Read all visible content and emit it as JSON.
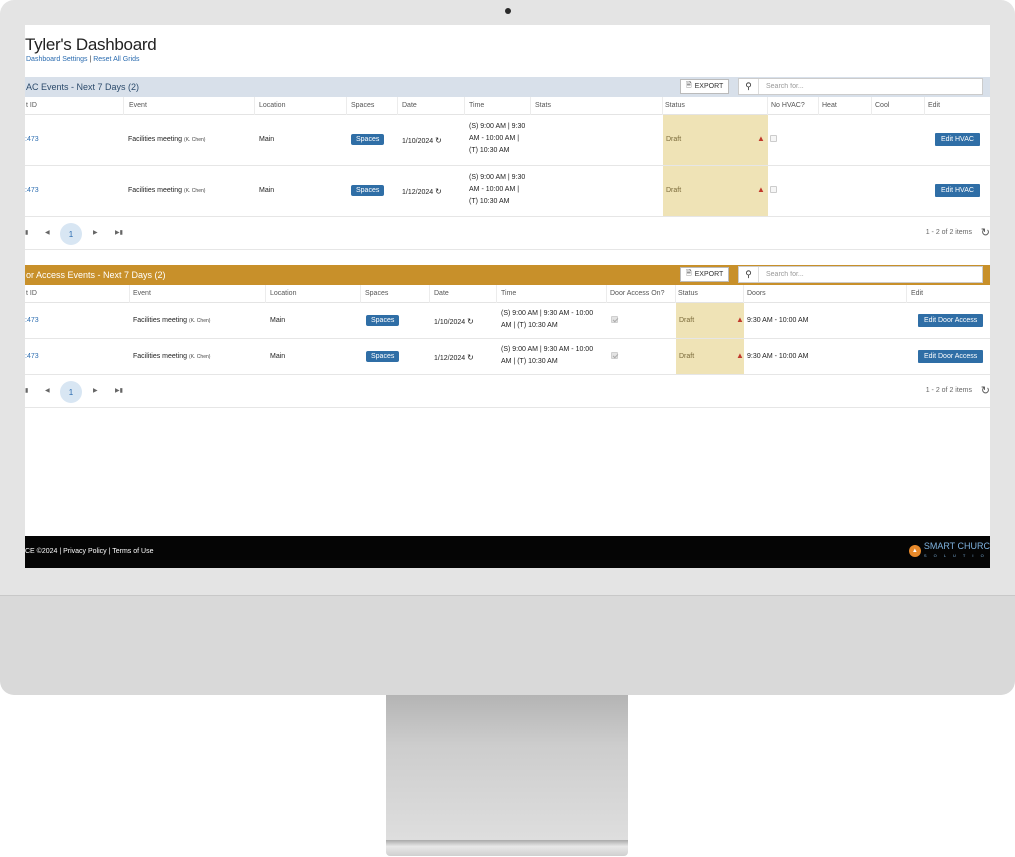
{
  "header": {
    "title": "Tyler's Dashboard",
    "settings_link": "Dashboard Settings",
    "separator": "|",
    "reset_link": "Reset All Grids"
  },
  "hvac": {
    "title": "AC Events - Next 7 Days (2)",
    "export_label": "EXPORT",
    "search_placeholder": "Search for...",
    "columns": [
      "t ID",
      "Event",
      "Location",
      "Spaces",
      "Date",
      "Time",
      "Stats",
      "Status",
      "No HVAC?",
      "Heat",
      "Cool",
      "Edit"
    ],
    "rows": [
      {
        "id": ":473",
        "event": "Facilities meeting",
        "event_note": "(K. Chen)",
        "location": "Main",
        "spaces": "Spaces",
        "date": "1/10/2024",
        "time_lines": [
          "(S) 9:00 AM | 9:30",
          "AM - 10:00 AM |",
          "(T) 10:30 AM"
        ],
        "status": "Draft",
        "edit": "Edit HVAC"
      },
      {
        "id": ":473",
        "event": "Facilities meeting",
        "event_note": "(K. Chen)",
        "location": "Main",
        "spaces": "Spaces",
        "date": "1/12/2024",
        "time_lines": [
          "(S) 9:00 AM | 9:30",
          "AM - 10:00 AM |",
          "(T) 10:30 AM"
        ],
        "status": "Draft",
        "edit": "Edit HVAC"
      }
    ],
    "pager": {
      "page": "1",
      "count": "1 - 2 of 2 items"
    }
  },
  "door": {
    "title": "or Access Events - Next 7 Days (2)",
    "export_label": "EXPORT",
    "search_placeholder": "Search for...",
    "columns": [
      "t ID",
      "Event",
      "Location",
      "Spaces",
      "Date",
      "Time",
      "Door Access On?",
      "Status",
      "Doors",
      "Edit"
    ],
    "rows": [
      {
        "id": ":473",
        "event": "Facilities meeting",
        "event_note": "(K. Chen)",
        "location": "Main",
        "spaces": "Spaces",
        "date": "1/10/2024",
        "time_lines": [
          "(S) 9:00 AM | 9:30 AM - 10:00",
          "AM | (T) 10:30 AM"
        ],
        "status": "Draft",
        "doors": "9:30 AM - 10:00 AM",
        "edit": "Edit Door Access"
      },
      {
        "id": ":473",
        "event": "Facilities meeting",
        "event_note": "(K. Chen)",
        "location": "Main",
        "spaces": "Spaces",
        "date": "1/12/2024",
        "time_lines": [
          "(S) 9:00 AM | 9:30 AM - 10:00",
          "AM | (T) 10:30 AM"
        ],
        "status": "Draft",
        "doors": "9:30 AM - 10:00 AM",
        "edit": "Edit Door Access"
      }
    ],
    "pager": {
      "page": "1",
      "count": "1 - 2 of 2 items"
    }
  },
  "footer": {
    "text": "CE ©2024 | Privacy Policy | Terms of Use",
    "brand_name": "SMART CHURC",
    "brand_sub": "S O L U T I O"
  },
  "colors": {
    "hvac_header": "#d8e0ea",
    "door_header": "#c8902a",
    "button_blue": "#2f6ea6",
    "status_draft": "#efe3b6",
    "footer_bg": "#050505"
  }
}
